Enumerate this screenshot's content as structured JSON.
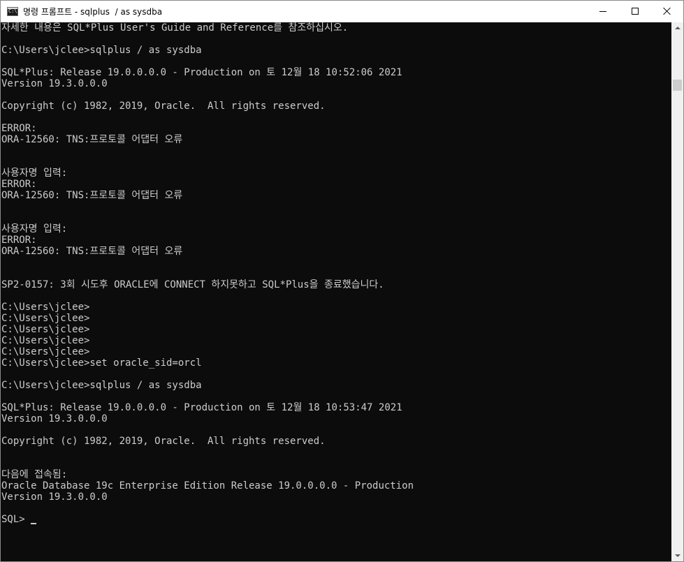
{
  "window": {
    "title": "명령 프롬프트 - sqlplus  / as sysdba",
    "icon_label": "C:\\",
    "icon_name": "cmd-icon",
    "controls": {
      "minimize": "minimize-icon",
      "maximize": "maximize-icon",
      "close": "close-icon"
    }
  },
  "colors": {
    "console_background": "#0c0c0c",
    "console_text": "#cccccc",
    "title_bar": "#ffffff",
    "scrollbar_track": "#f0f0f0",
    "scrollbar_thumb": "#cdcdcd"
  },
  "console": {
    "lines": [
      "자세한 내용은 SQL*Plus User's Guide and Reference를 참조하십시오.",
      "",
      "C:\\Users\\jclee>sqlplus / as sysdba",
      "",
      "SQL*Plus: Release 19.0.0.0.0 - Production on 토 12월 18 10:52:06 2021",
      "Version 19.3.0.0.0",
      "",
      "Copyright (c) 1982, 2019, Oracle.  All rights reserved.",
      "",
      "ERROR:",
      "ORA-12560: TNS:프로토콜 어댑터 오류",
      "",
      "",
      "사용자명 입력:",
      "ERROR:",
      "ORA-12560: TNS:프로토콜 어댑터 오류",
      "",
      "",
      "사용자명 입력:",
      "ERROR:",
      "ORA-12560: TNS:프로토콜 어댑터 오류",
      "",
      "",
      "SP2-0157: 3회 시도후 ORACLE에 CONNECT 하지못하고 SQL*Plus을 종료했습니다.",
      "",
      "C:\\Users\\jclee>",
      "C:\\Users\\jclee>",
      "C:\\Users\\jclee>",
      "C:\\Users\\jclee>",
      "C:\\Users\\jclee>",
      "C:\\Users\\jclee>set oracle_sid=orcl",
      "",
      "C:\\Users\\jclee>sqlplus / as sysdba",
      "",
      "SQL*Plus: Release 19.0.0.0.0 - Production on 토 12월 18 10:53:47 2021",
      "Version 19.3.0.0.0",
      "",
      "Copyright (c) 1982, 2019, Oracle.  All rights reserved.",
      "",
      "",
      "다음에 접속됨:",
      "Oracle Database 19c Enterprise Edition Release 19.0.0.0.0 - Production",
      "Version 19.3.0.0.0",
      "",
      "SQL> "
    ],
    "prompt_line_index": 44
  }
}
